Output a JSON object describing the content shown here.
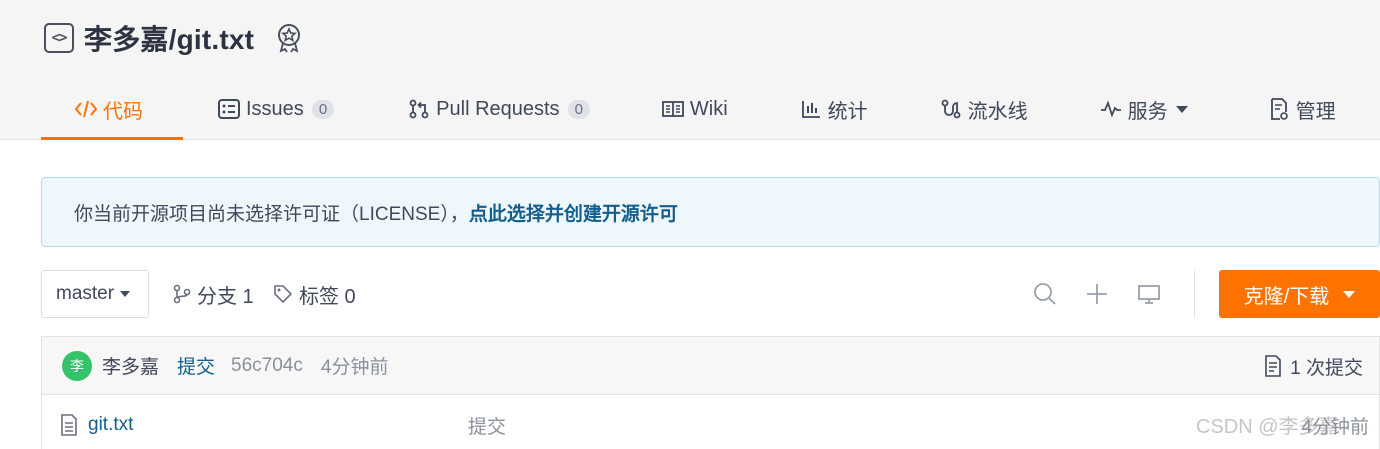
{
  "repo": {
    "icon": "code-brackets-icon",
    "name": "李多嘉/git.txt",
    "badge_icon": "award-badge-icon"
  },
  "tabs": [
    {
      "label": "代码",
      "icon": "code-icon",
      "active": true
    },
    {
      "label": "Issues",
      "icon": "issues-icon",
      "count": "0"
    },
    {
      "label": "Pull Requests",
      "icon": "pull-request-icon",
      "count": "0"
    },
    {
      "label": "Wiki",
      "icon": "book-icon"
    },
    {
      "label": "统计",
      "icon": "bar-chart-icon"
    },
    {
      "label": "流水线",
      "icon": "pipeline-icon"
    },
    {
      "label": "服务",
      "icon": "pulse-icon",
      "dropdown": true
    },
    {
      "label": "管理",
      "icon": "settings-doc-icon"
    }
  ],
  "notice": {
    "text": "你当前开源项目尚未选择许可证（LICENSE），",
    "link": "点此选择并创建开源许可"
  },
  "toolbar": {
    "branch": "master",
    "branches_label": "分支 1",
    "tags_label": "标签 0",
    "clone_label": "克隆/下载"
  },
  "commit": {
    "avatar_text": "李",
    "author": "李多嘉",
    "action": "提交",
    "hash": "56c704c",
    "time": "4分钟前",
    "count_label": "1 次提交"
  },
  "files": [
    {
      "name": "git.txt",
      "message": "提交",
      "time": "4分钟前"
    }
  ],
  "watermark": "CSDN @李多嘉",
  "colors": {
    "accent": "#fe7300",
    "link": "#135e8c",
    "notice_bg": "#eef7fb",
    "avatar": "#34c26a"
  }
}
